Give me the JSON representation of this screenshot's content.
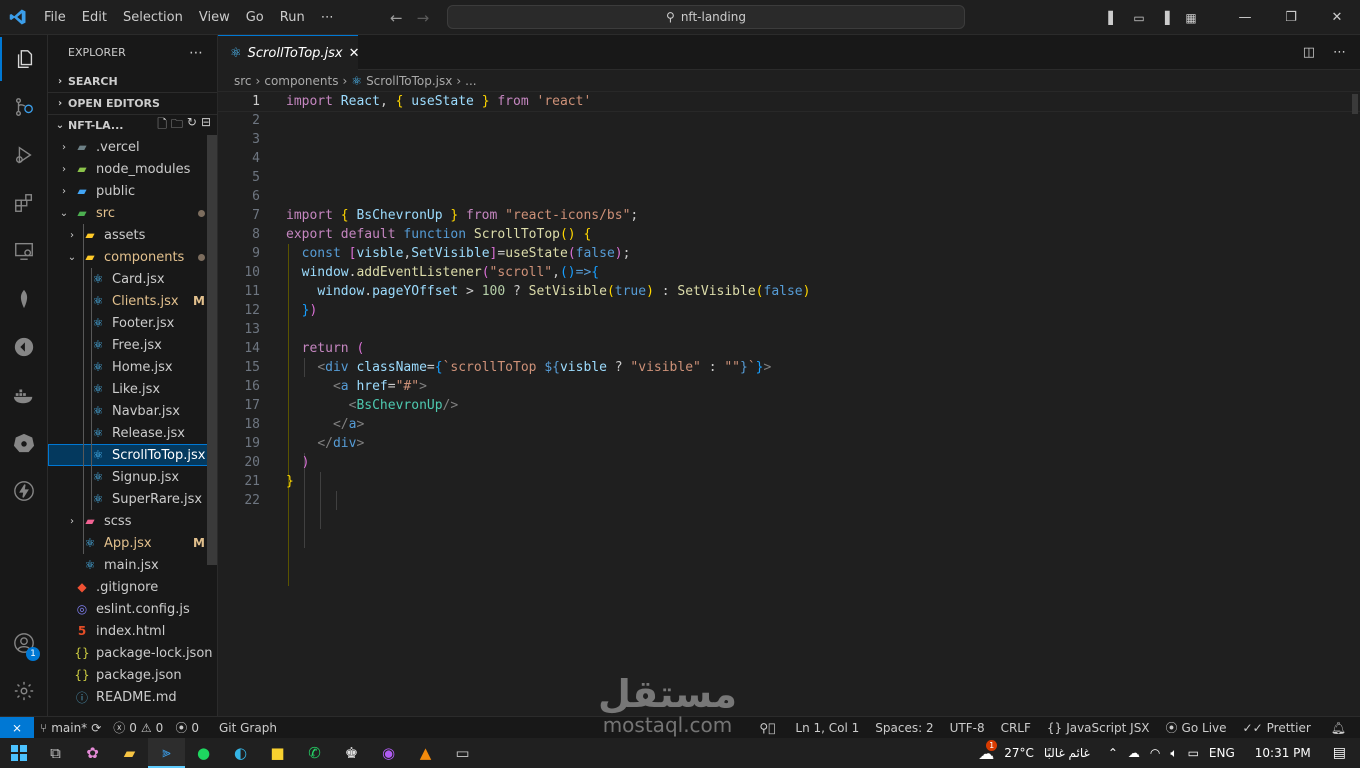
{
  "titlebar": {
    "menu": [
      "File",
      "Edit",
      "Selection",
      "View",
      "Go",
      "Run",
      "⋯"
    ],
    "search": "nft-landing"
  },
  "explorer": {
    "title": "EXPLORER",
    "sections": {
      "search": "SEARCH",
      "open_editors": "OPEN EDITORS",
      "root": "NFT-LA..."
    },
    "files": [
      {
        "name": ".vercel",
        "kind": "folder",
        "status": ""
      },
      {
        "name": "node_modules",
        "kind": "folder",
        "status": ""
      },
      {
        "name": "public",
        "kind": "folder",
        "status": ""
      },
      {
        "name": "src",
        "kind": "folder",
        "status": "dot"
      },
      {
        "name": "assets",
        "kind": "folder",
        "status": ""
      },
      {
        "name": "components",
        "kind": "folder",
        "status": "dot"
      },
      {
        "name": "Card.jsx",
        "kind": "react",
        "status": ""
      },
      {
        "name": "Clients.jsx",
        "kind": "react",
        "status": "M"
      },
      {
        "name": "Footer.jsx",
        "kind": "react",
        "status": ""
      },
      {
        "name": "Free.jsx",
        "kind": "react",
        "status": ""
      },
      {
        "name": "Home.jsx",
        "kind": "react",
        "status": ""
      },
      {
        "name": "Like.jsx",
        "kind": "react",
        "status": ""
      },
      {
        "name": "Navbar.jsx",
        "kind": "react",
        "status": ""
      },
      {
        "name": "Release.jsx",
        "kind": "react",
        "status": ""
      },
      {
        "name": "ScrollToTop.jsx",
        "kind": "react",
        "status": "",
        "selected": true
      },
      {
        "name": "Signup.jsx",
        "kind": "react",
        "status": ""
      },
      {
        "name": "SuperRare.jsx",
        "kind": "react",
        "status": ""
      },
      {
        "name": "scss",
        "kind": "folder",
        "status": ""
      },
      {
        "name": "App.jsx",
        "kind": "react",
        "status": "M"
      },
      {
        "name": "main.jsx",
        "kind": "react",
        "status": ""
      },
      {
        "name": ".gitignore",
        "kind": "git",
        "status": ""
      },
      {
        "name": "eslint.config.js",
        "kind": "eslint",
        "status": ""
      },
      {
        "name": "index.html",
        "kind": "html",
        "status": ""
      },
      {
        "name": "package-lock.json",
        "kind": "json",
        "status": ""
      },
      {
        "name": "package.json",
        "kind": "json",
        "status": ""
      },
      {
        "name": "README.md",
        "kind": "info",
        "status": ""
      }
    ]
  },
  "editor": {
    "tab": "ScrollToTop.jsx",
    "breadcrumb": [
      "src",
      "components",
      "ScrollToTop.jsx",
      "..."
    ],
    "line_numbers": [
      "1",
      "2",
      "3",
      "4",
      "5",
      "6",
      "7",
      "8",
      "9",
      "10",
      "11",
      "12",
      "13",
      "14",
      "15",
      "16",
      "17",
      "18",
      "19",
      "20",
      "21",
      "22"
    ]
  },
  "statusbar": {
    "branch": "main*",
    "errors": "0",
    "warnings": "0",
    "ports": "0",
    "git_graph": "Git Graph",
    "position": "Ln 1, Col 1",
    "spaces": "Spaces: 2",
    "encoding": "UTF-8",
    "eol": "CRLF",
    "language": "JavaScript JSX",
    "golive": "Go Live",
    "prettier": "Prettier"
  },
  "taskbar": {
    "temperature": "27°C",
    "weather": "غائم غالبًا",
    "lang": "ENG",
    "time": "10:31 PM",
    "weather_badge": "1"
  },
  "account_badge": "1",
  "watermark": {
    "arabic": "مستقل",
    "latin": "mostaql.com"
  },
  "colors": {
    "accent": "#0078d4",
    "modified": "#e2c08d",
    "react": "#4fc1ff"
  }
}
